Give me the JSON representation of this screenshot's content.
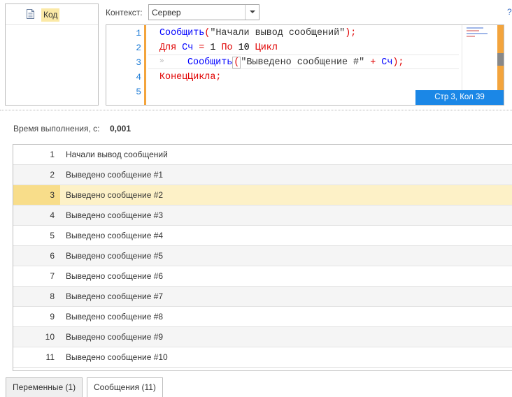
{
  "tree": {
    "items": [
      {
        "label": "Код",
        "icon": "document-icon"
      }
    ]
  },
  "context": {
    "label": "Контекст:",
    "value": "Сервер",
    "help": "?"
  },
  "editor": {
    "line_numbers": [
      "1",
      "2",
      "3",
      "4",
      "5"
    ],
    "lines": {
      "l1": {
        "fn": "Сообщить",
        "open": "(",
        "str": "\"Начали вывод сообщений\"",
        "close": ");"
      },
      "l2": {
        "kw1": "Для",
        "var": "Сч",
        "eq": "=",
        "from": "1",
        "kw2": "По",
        "to": "10",
        "kw3": "Цикл"
      },
      "l3": {
        "tab": "»",
        "fn": "Сообщить",
        "open": "(",
        "str": "\"Выведено сообщение #\"",
        "plus": "+",
        "var": "Сч",
        "close": ");"
      },
      "l4": {
        "kw": "КонецЦикла;"
      }
    },
    "status": "Стр 3, Кол 39"
  },
  "execution": {
    "label": "Время выполнения, с:",
    "value": "0,001"
  },
  "results": {
    "selected_index": 2,
    "rows": [
      {
        "num": "1",
        "msg": "Начали вывод сообщений"
      },
      {
        "num": "2",
        "msg": "Выведено сообщение #1"
      },
      {
        "num": "3",
        "msg": "Выведено сообщение #2"
      },
      {
        "num": "4",
        "msg": "Выведено сообщение #3"
      },
      {
        "num": "5",
        "msg": "Выведено сообщение #4"
      },
      {
        "num": "6",
        "msg": "Выведено сообщение #5"
      },
      {
        "num": "7",
        "msg": "Выведено сообщение #6"
      },
      {
        "num": "8",
        "msg": "Выведено сообщение #7"
      },
      {
        "num": "9",
        "msg": "Выведено сообщение #8"
      },
      {
        "num": "10",
        "msg": "Выведено сообщение #9"
      },
      {
        "num": "11",
        "msg": "Выведено сообщение #10"
      }
    ]
  },
  "tabs": [
    {
      "label": "Переменные (1)",
      "active": false
    },
    {
      "label": "Сообщения (11)",
      "active": true
    }
  ],
  "colors": {
    "selection_fill": "#fdf1c7",
    "selection_number_fill": "#f8dd8a",
    "accent_orange": "#f3a43c",
    "status_blue": "#1b87e6",
    "keyword_red": "#e00000",
    "function_blue": "#0000ff",
    "line_number_blue": "#1c7bd6"
  }
}
